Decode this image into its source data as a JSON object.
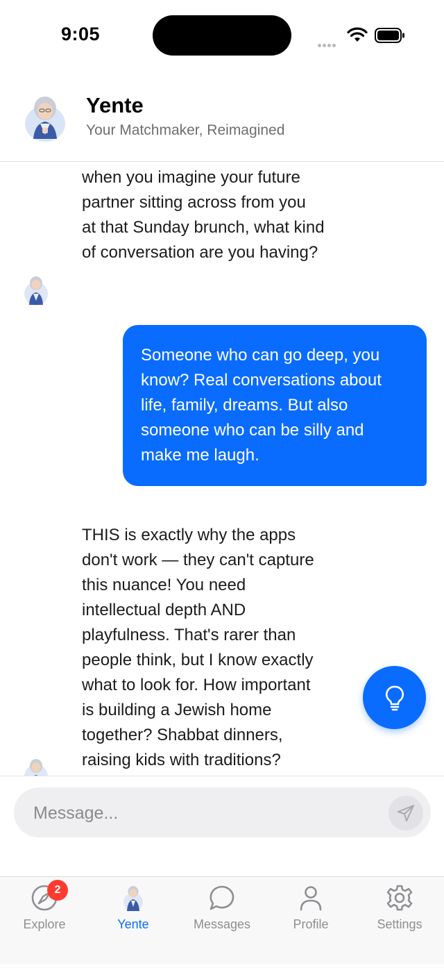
{
  "status_bar": {
    "time": "9:05"
  },
  "header": {
    "title": "Yente",
    "subtitle": "Your Matchmaker, Reimagined",
    "avatar_icon": "grandmother-avatar-icon"
  },
  "chat": {
    "messages": [
      {
        "sender": "bot",
        "text": "when you imagine your future\npartner sitting across from you\nat that Sunday brunch, what kind\nof conversation are you having?"
      },
      {
        "sender": "user",
        "text": "Someone who can go deep, you\nknow? Real conversations about\nlife, family, dreams. But also\nsomeone who can be silly and\nmake me laugh."
      },
      {
        "sender": "bot",
        "text": "THIS is exactly why the apps\ndon't work — they can't capture\nthis nuance! You need\nintellectual depth AND\nplayfulness. That's rarer than\npeople think, but I know exactly\nwhat to look for. How important\nis building a Jewish home\ntogether? Shabbat dinners,\nraising kids with traditions?"
      }
    ],
    "fab_icon": "lightbulb-icon"
  },
  "composer": {
    "placeholder": "Message...",
    "value": "",
    "send_icon": "send-icon"
  },
  "tabbar": {
    "tabs": [
      {
        "label": "Explore",
        "icon": "compass-icon",
        "badge": "2",
        "active": false
      },
      {
        "label": "Yente",
        "icon": "grandmother-avatar-icon",
        "active": true
      },
      {
        "label": "Messages",
        "icon": "chat-bubble-icon",
        "active": false
      },
      {
        "label": "Profile",
        "icon": "person-icon",
        "active": false
      },
      {
        "label": "Settings",
        "icon": "gear-icon",
        "active": false
      }
    ]
  },
  "colors": {
    "accent": "#0a6cff",
    "badge": "#ff3b30",
    "inactive_tab": "#8e8e93"
  }
}
